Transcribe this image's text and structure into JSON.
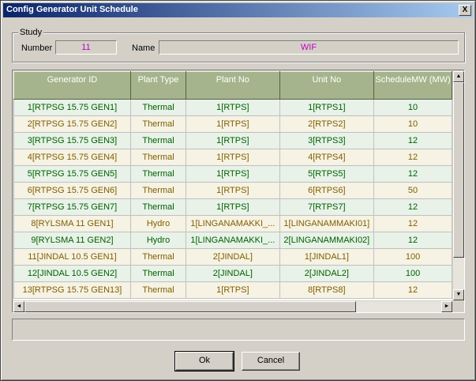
{
  "window": {
    "title": "Config Generator Unit Schedule",
    "close_glyph": "X"
  },
  "study": {
    "legend": "Study",
    "number_label": "Number",
    "number_value": "11",
    "name_label": "Name",
    "name_value": "WIF"
  },
  "grid": {
    "columns": [
      "Generator ID",
      "Plant Type",
      "Plant No",
      "Unit No",
      "ScheduleMW (MW)"
    ],
    "rows": [
      {
        "style": "green",
        "cells": [
          "1[RTPSG 15.75 GEN1]",
          "Thermal",
          "1[RTPS]",
          "1[RTPS1]",
          "10"
        ]
      },
      {
        "style": "tan",
        "cells": [
          "2[RTPSG 15.75 GEN2]",
          "Thermal",
          "1[RTPS]",
          "2[RTPS2]",
          "10"
        ]
      },
      {
        "style": "green",
        "cells": [
          "3[RTPSG 15.75 GEN3]",
          "Thermal",
          "1[RTPS]",
          "3[RTPS3]",
          "12"
        ]
      },
      {
        "style": "tan",
        "cells": [
          "4[RTPSG 15.75 GEN4]",
          "Thermal",
          "1[RTPS]",
          "4[RTPS4]",
          "12"
        ]
      },
      {
        "style": "green",
        "cells": [
          "5[RTPSG 15.75 GEN5]",
          "Thermal",
          "1[RTPS]",
          "5[RTPS5]",
          "12"
        ]
      },
      {
        "style": "tan",
        "cells": [
          "6[RTPSG 15.75 GEN6]",
          "Thermal",
          "1[RTPS]",
          "6[RTPS6]",
          "50"
        ]
      },
      {
        "style": "green",
        "cells": [
          "7[RTPSG 15.75 GEN7]",
          "Thermal",
          "1[RTPS]",
          "7[RTPS7]",
          "12"
        ]
      },
      {
        "style": "tan",
        "cells": [
          "8[RYLSMA 11 GEN1]",
          "Hydro",
          "1[LINGANAMAKKI_...",
          "1[LINGANAMMAKI01]",
          "12"
        ]
      },
      {
        "style": "green",
        "cells": [
          "9[RYLSMA 11 GEN2]",
          "Hydro",
          "1[LINGANAMAKKI_...",
          "2[LINGANAMMAKI02]",
          "12"
        ]
      },
      {
        "style": "tan",
        "cells": [
          "11[JINDAL 10.5 GEN1]",
          "Thermal",
          "2[JINDAL]",
          "1[JINDAL1]",
          "100"
        ]
      },
      {
        "style": "green",
        "cells": [
          "12[JINDAL 10.5 GEN2]",
          "Thermal",
          "2[JINDAL]",
          "2[JINDAL2]",
          "100"
        ]
      },
      {
        "style": "tan",
        "cells": [
          "13[RTPSG 15.75 GEN13]",
          "Thermal",
          "1[RTPS]",
          "8[RTPS8]",
          "12"
        ]
      }
    ]
  },
  "scroll": {
    "up": "▲",
    "down": "▼",
    "left": "◄",
    "right": "►"
  },
  "buttons": {
    "ok": "Ok",
    "cancel": "Cancel"
  }
}
